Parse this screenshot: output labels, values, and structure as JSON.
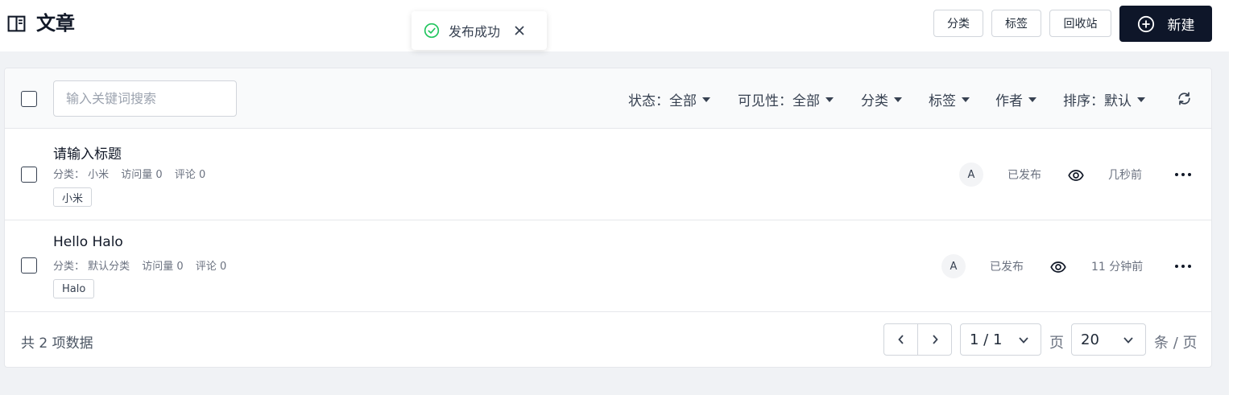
{
  "header": {
    "title": "文章",
    "buttons": {
      "category": "分类",
      "tag": "标签",
      "recycle": "回收站",
      "new": "新建"
    }
  },
  "toast": {
    "message": "发布成功"
  },
  "toolbar": {
    "search_placeholder": "输入关键词搜索",
    "filters": {
      "status": "状态：全部",
      "visibility": "可见性：全部",
      "category": "分类",
      "tag": "标签",
      "author": "作者",
      "sort": "排序：默认"
    }
  },
  "posts": [
    {
      "title": "请输入标题",
      "category": "分类：  小米",
      "visits": "访问量 0",
      "comments": "评论 0",
      "tag": "小米",
      "author_initial": "A",
      "status": "已发布",
      "time": "几秒前"
    },
    {
      "title": "Hello Halo",
      "category": "分类：  默认分类",
      "visits": "访问量 0",
      "comments": "评论 0",
      "tag": "Halo",
      "author_initial": "A",
      "status": "已发布",
      "time": "11 分钟前"
    }
  ],
  "footer": {
    "total": "共 2 项数据",
    "page": "1 / 1",
    "page_label": "页",
    "size": "20",
    "size_label": "条 / 页"
  },
  "colors": {
    "primary": "#0e1629",
    "success": "#22c55e",
    "background": "#f0f2f5"
  },
  "icons": [
    "book-open-icon",
    "check-circle-icon",
    "close-icon",
    "add-circle-icon",
    "caret-down-icon",
    "refresh-icon",
    "eye-icon",
    "more-icon",
    "chevron-left-icon",
    "chevron-right-icon",
    "chevron-down-icon"
  ]
}
